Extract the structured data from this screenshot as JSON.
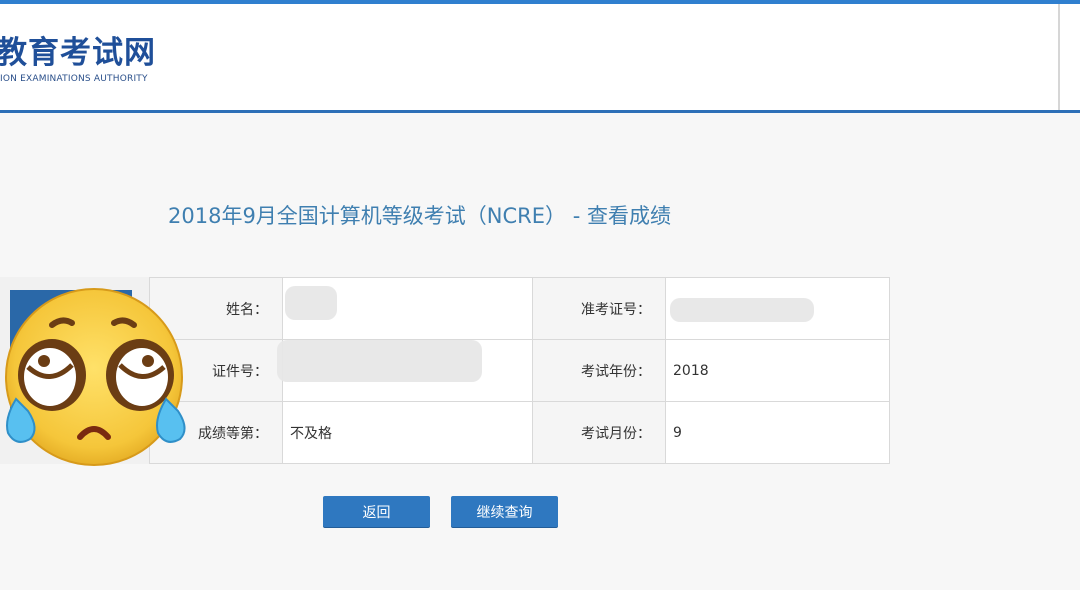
{
  "header": {
    "logo_cn": "教育考试网",
    "logo_en": "ION EXAMINATIONS AUTHORITY"
  },
  "page": {
    "title": "2018年9月全国计算机等级考试（NCRE） - 查看成绩"
  },
  "result": {
    "name_label": "姓名：",
    "name_value": "",
    "ticket_label": "准考证号：",
    "ticket_value": "",
    "id_label": "证件号：",
    "id_value": "",
    "year_label": "考试年份：",
    "year_value": "2018",
    "grade_label": "成绩等第：",
    "grade_value": "不及格",
    "month_label": "考试月份：",
    "month_value": "9"
  },
  "buttons": {
    "back": "返回",
    "continue": "继续查询"
  },
  "colors": {
    "brand_blue": "#2d6fb7",
    "title_blue": "#3f7fb0",
    "button_blue": "#2f78c0"
  }
}
